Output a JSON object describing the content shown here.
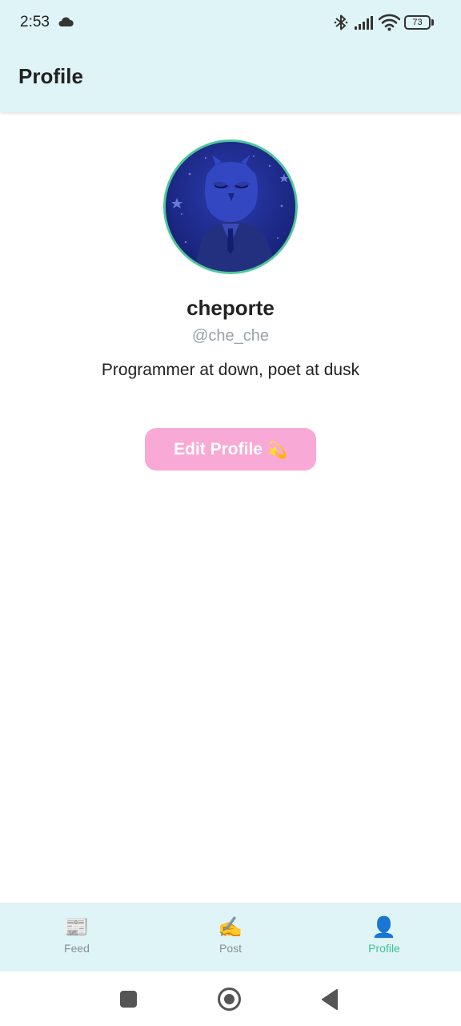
{
  "status_bar": {
    "time": "2:53",
    "battery_level": "73",
    "icons": [
      "cloud-icon",
      "bluetooth-icon",
      "signal-icon",
      "wifi-icon",
      "battery-icon"
    ]
  },
  "app_bar": {
    "title": "Profile"
  },
  "profile": {
    "username": "cheporte",
    "handle": "@che_che",
    "bio": "Programmer at down, poet at dusk",
    "avatar_icon": "owl-avatar-image",
    "edit_button_label": "Edit Profile",
    "edit_button_emoji": "💫"
  },
  "bottom_nav": {
    "items": [
      {
        "label": "Feed",
        "icon": "📰"
      },
      {
        "label": "Post",
        "icon": "✍️"
      },
      {
        "label": "Profile",
        "icon": "👤"
      }
    ],
    "active": "Profile"
  },
  "colors": {
    "header_bg": "#dff4f7",
    "accent_green": "#3ec48e",
    "edit_button_bg": "#f8a9d6",
    "avatar_border": "#4fc79a"
  }
}
